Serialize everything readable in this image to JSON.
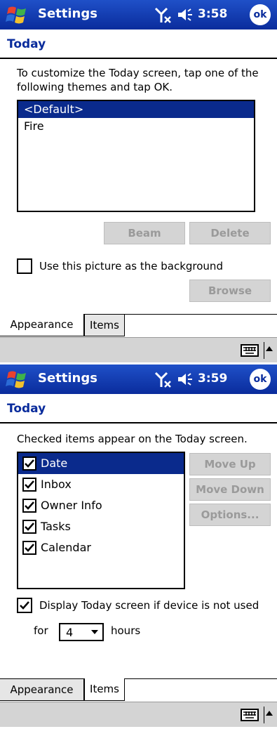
{
  "screen1": {
    "app_title": "Settings",
    "time": "3:58",
    "ok_label": "ok",
    "page_heading": "Today",
    "instruction": "To customize the Today screen, tap one of the following themes and tap OK.",
    "themes": [
      {
        "label": "<Default>",
        "selected": true
      },
      {
        "label": "Fire",
        "selected": false
      }
    ],
    "beam_label": "Beam",
    "delete_label": "Delete",
    "background_checkbox_label": "Use this picture as the background",
    "browse_label": "Browse",
    "tabs": [
      "Appearance",
      "Items"
    ],
    "active_tab": "Appearance"
  },
  "screen2": {
    "app_title": "Settings",
    "time": "3:59",
    "ok_label": "ok",
    "page_heading": "Today",
    "instruction": "Checked items appear on the Today screen.",
    "items": [
      {
        "label": "Date",
        "checked": true,
        "selected": true
      },
      {
        "label": "Inbox",
        "checked": true,
        "selected": false
      },
      {
        "label": "Owner Info",
        "checked": true,
        "selected": false
      },
      {
        "label": "Tasks",
        "checked": true,
        "selected": false
      },
      {
        "label": "Calendar",
        "checked": true,
        "selected": false
      }
    ],
    "move_up_label": "Move Up",
    "move_down_label": "Move Down",
    "options_label": "Options...",
    "display_checkbox_label": "Display Today screen if device is not used",
    "for_label": "for",
    "hours_value": "4",
    "hours_label": "hours",
    "tabs": [
      "Appearance",
      "Items"
    ],
    "active_tab": "Items"
  },
  "icons": {
    "start": "windows-flag-icon",
    "antenna": "antenna-off-icon",
    "speaker": "speaker-icon",
    "keyboard": "keyboard-icon"
  },
  "colors": {
    "titlebar": "#1f50c8",
    "selection": "#0a2a8c",
    "heading": "#0a2c9c",
    "button_disabled": "#d4d4d4"
  }
}
